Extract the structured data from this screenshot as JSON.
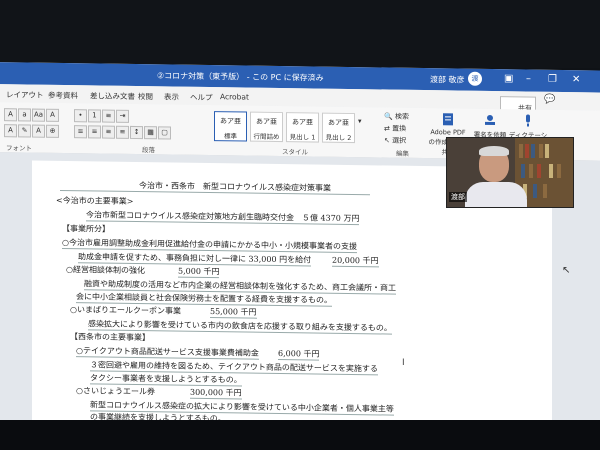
{
  "window": {
    "doc_title": "②コロナ対策（東予版） - この PC に保存済み",
    "user_name": "渡部 敬彦",
    "avatar_text": "渡"
  },
  "menu": {
    "items": [
      "レイアウト",
      "参考資料",
      "差し込み文書",
      "校閲",
      "表示",
      "ヘルプ",
      "Acrobat"
    ],
    "share_label": "共有"
  },
  "ribbon": {
    "styles": [
      {
        "preview": "あア亜",
        "name": "標準"
      },
      {
        "preview": "あア亜",
        "name": "行間詰め"
      },
      {
        "preview": "あア亜",
        "name": "見出し 1"
      },
      {
        "preview": "あア亜",
        "name": "見出し 2"
      }
    ],
    "edit_tools": [
      "検索",
      "置換",
      "選択"
    ],
    "adobe_tool": "Adobe PDF の作成および共有",
    "sign_tool": "署名を依頼",
    "dictation_tool": "ディクテーション",
    "groups": {
      "font": "フォント",
      "paragraph": "段落",
      "style": "スタイル",
      "edit": "編集"
    }
  },
  "document": {
    "title": "今治市・西条市　新型コロナウイルス感染症対策事業",
    "lines": [
      "<今治市の主要事業>",
      "今治市新型コロナウイルス感染症対策地方創生臨時交付金　５億 4370 万円",
      "【事業所分】",
      "○今治市雇用調整助成金利用促進給付金の申請にかかる中小・小規模事業者の支援",
      "助成金申請を促すため、事務負担に対し一律に 33,000 円を給付",
      "20,000 千円",
      "○経営相談体制の強化",
      "5,000 千円",
      "融資や助成制度の活用など市内企業の経営相談体制を強化するため、商工会議所・商工",
      "会に中小企業相談員と社会保険労務士を配置する経費を支援するもの。",
      "○いまばりエールクーポン事業",
      "55,000 千円",
      "感染拡大により影響を受けている市内の飲食店を応援する取り組みを支援するもの。",
      "【西条市の主要事業】",
      "○テイクアウト商品配送サービス支援事業費補助金",
      "6,000 千円",
      "３密回避や雇用の維持を図るため、テイクアウト商品の配送サービスを実施する",
      "タクシー事業者を支援しようとするもの。",
      "○さいじょうエール券",
      "300,000 千円",
      "新型コロナウイルス感染症の拡大により影響を受けている中小企業者・個人事業主等",
      "の事業継続を支援しようとするもの。"
    ]
  },
  "video": {
    "participant_name": "渡部"
  }
}
